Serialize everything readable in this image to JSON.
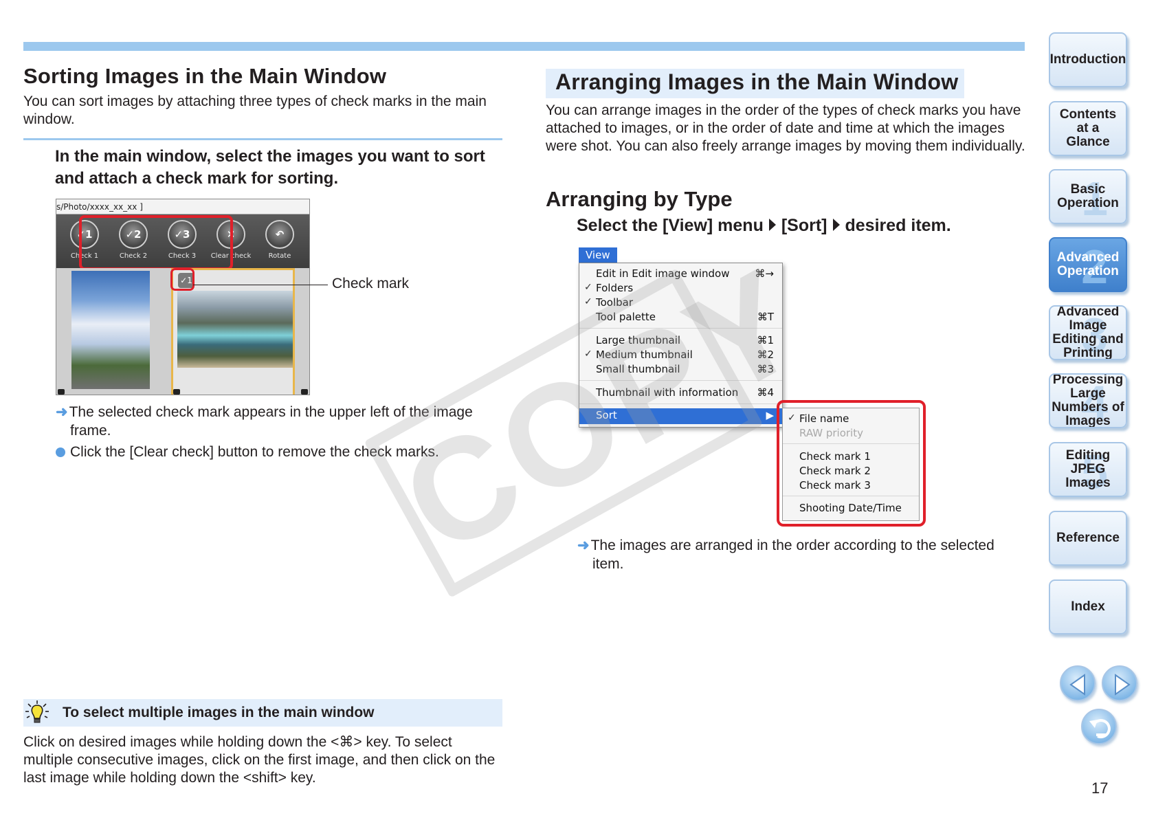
{
  "left": {
    "title": "Sorting Images in the Main Window",
    "intro": "You can sort images by attaching three types of check marks in the main window.",
    "step": "In the main window, select the images you want to sort and attach a check mark for sorting.",
    "screenshot": {
      "path": "s/Photo/xxxx_xx_xx ]",
      "buttons": [
        "Check 1",
        "Check 2",
        "Check 3",
        "Clear check",
        "Rotate"
      ]
    },
    "callout": "Check mark",
    "result_line1": "The selected check mark appears in the upper left of the image",
    "result_line2": "frame.",
    "bullet": "Click the [Clear check] button to remove the check marks.",
    "tip_title": "To select multiple images in the main window",
    "tip_body": "Click on desired images while holding down the <⌘> key. To select multiple consecutive images, click on the first image, and then click on the last image while holding down the <shift> key."
  },
  "right": {
    "title": "Arranging Images in the Main Window",
    "intro": "You can arrange images in the order of the types of check marks you have attached to images, or in the order of date and time at which the images were shot. You can also freely arrange images by moving them individually.",
    "subtitle": "Arranging by Type",
    "step_a": "Select the [View] menu",
    "step_b": "[Sort]",
    "step_c": "desired item.",
    "menu": {
      "title": "View",
      "items": [
        {
          "label": "Edit in Edit image window",
          "shortcut": "⌘→",
          "checked": ""
        },
        {
          "label": "Folders",
          "shortcut": "",
          "checked": "✓"
        },
        {
          "label": "Toolbar",
          "shortcut": "",
          "checked": "✓"
        },
        {
          "label": "Tool palette",
          "shortcut": "⌘T",
          "checked": ""
        },
        {
          "label": "Large thumbnail",
          "shortcut": "⌘1",
          "checked": ""
        },
        {
          "label": "Medium thumbnail",
          "shortcut": "⌘2",
          "checked": "✓"
        },
        {
          "label": "Small thumbnail",
          "shortcut": "⌘3",
          "checked": ""
        },
        {
          "label": "Thumbnail with information",
          "shortcut": "⌘4",
          "checked": ""
        },
        {
          "label": "Sort",
          "shortcut": "▶",
          "checked": ""
        }
      ]
    },
    "submenu": [
      {
        "label": "File name",
        "checked": "✓"
      },
      {
        "label": "RAW priority",
        "checked": ""
      },
      {
        "label": "Check mark 1",
        "checked": ""
      },
      {
        "label": "Check mark 2",
        "checked": ""
      },
      {
        "label": "Check mark 3",
        "checked": ""
      },
      {
        "label": "Shooting Date/Time",
        "checked": ""
      }
    ],
    "result_line1": "The images are arranged in the order according to the selected",
    "result_line2": "item."
  },
  "watermark": "COPY",
  "nav": [
    {
      "label": "Introduction",
      "num": ""
    },
    {
      "label": "Contents at a Glance",
      "num": ""
    },
    {
      "label": "Basic Operation",
      "num": "1"
    },
    {
      "label": "Advanced Operation",
      "num": "2"
    },
    {
      "label": "Advanced Image Editing and Printing",
      "num": "3"
    },
    {
      "label": "Processing Large Numbers of Images",
      "num": "4"
    },
    {
      "label": "Editing JPEG Images",
      "num": "5"
    },
    {
      "label": "Reference",
      "num": ""
    },
    {
      "label": "Index",
      "num": ""
    }
  ],
  "page_number": "17",
  "colors": {
    "accent": "#9cc8ee",
    "active_nav": "#4a8ad4",
    "highlight": "#e0202a"
  }
}
